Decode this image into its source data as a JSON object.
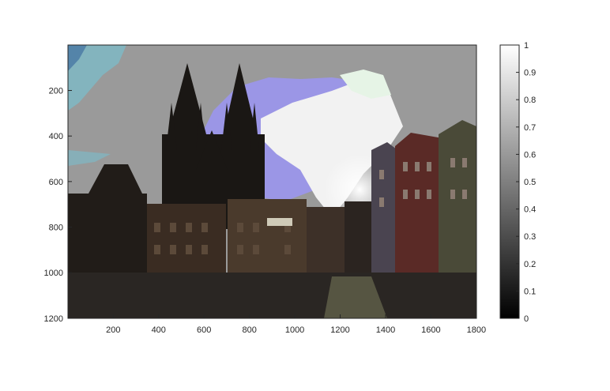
{
  "chart_data": {
    "type": "heatmap",
    "title": "",
    "xlabel": "",
    "ylabel": "",
    "content": "image",
    "xlim": [
      1,
      1800
    ],
    "ylim": [
      1,
      1200
    ],
    "y_reversed": true,
    "x_ticks": [
      200,
      400,
      600,
      800,
      1000,
      1200,
      1400,
      1600,
      1800
    ],
    "y_ticks": [
      200,
      400,
      600,
      800,
      1000,
      1200
    ],
    "colorbar": {
      "colormap": "gray",
      "clim": [
        0,
        1
      ],
      "ticks": [
        0,
        0.1,
        0.2,
        0.3,
        0.4,
        0.5,
        0.6,
        0.7,
        0.8,
        0.9,
        1
      ]
    }
  },
  "colors": {
    "axis": "#262626",
    "sky_gray": "#9a9a9a",
    "sky_lavender": "#9b96e6",
    "sky_white": "#f2f2f2",
    "sky_teal": "#7fb8c4",
    "building_dark": "#1a1714",
    "building_brown": "#3a2c22",
    "street": "#2a2623"
  }
}
